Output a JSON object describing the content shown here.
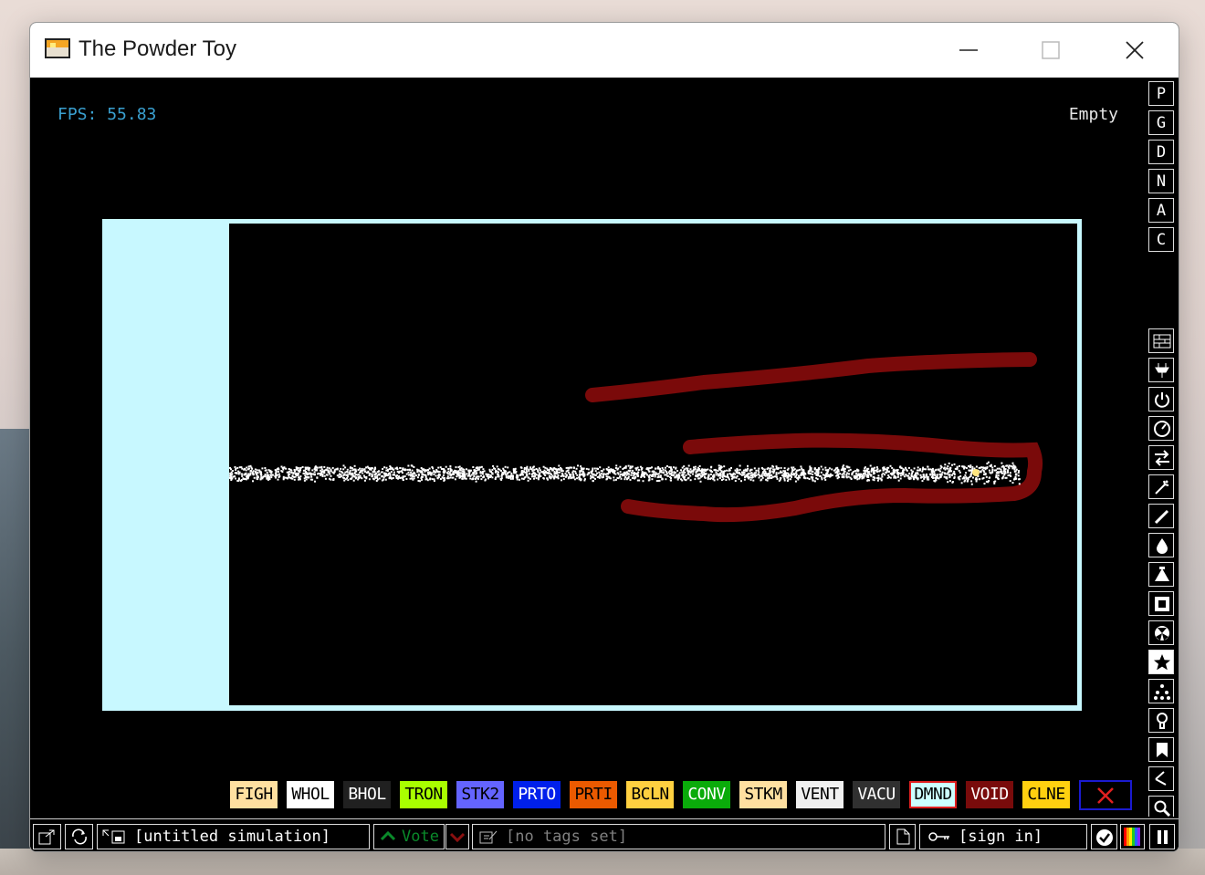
{
  "window": {
    "title": "The Powder Toy"
  },
  "hud": {
    "fps_label": "FPS:",
    "fps_value": "55.83",
    "hover_element": "Empty"
  },
  "right_toolbar": {
    "top_buttons": [
      "P",
      "G",
      "D",
      "N",
      "A",
      "C"
    ],
    "menu_icons": [
      "walls-icon",
      "electronics-icon",
      "powered-icon",
      "sensors-icon",
      "force-icon",
      "explosives-icon",
      "gases-icon",
      "liquids-icon",
      "powders-icon",
      "solids-icon",
      "radioactive-icon",
      "special-icon",
      "particles-icon",
      "life-icon",
      "tools-icon",
      "favorites-icon",
      "search-icon"
    ],
    "active_menu": "special-icon"
  },
  "elements": [
    {
      "name": "FIGH",
      "bg": "#ffe0a0",
      "fg": "#000000"
    },
    {
      "name": "WHOL",
      "bg": "#ffffff",
      "fg": "#000000"
    },
    {
      "name": "BHOL",
      "bg": "#202020",
      "fg": "#ffffff"
    },
    {
      "name": "TRON",
      "bg": "#a9ff00",
      "fg": "#000000"
    },
    {
      "name": "STK2",
      "bg": "#6464ff",
      "fg": "#000000"
    },
    {
      "name": "PRTO",
      "bg": "#0020eb",
      "fg": "#ffffff"
    },
    {
      "name": "PRTI",
      "bg": "#eb5a00",
      "fg": "#000000"
    },
    {
      "name": "BCLN",
      "bg": "#ffd040",
      "fg": "#000000"
    },
    {
      "name": "CONV",
      "bg": "#0aab0a",
      "fg": "#ffffff"
    },
    {
      "name": "STKM",
      "bg": "#ffe0a0",
      "fg": "#000000"
    },
    {
      "name": "VENT",
      "bg": "#f0f0f0",
      "fg": "#000000"
    },
    {
      "name": "VACU",
      "bg": "#303030",
      "fg": "#ffffff"
    },
    {
      "name": "DMND",
      "bg": "#ccffff",
      "fg": "#000000",
      "selected": true
    },
    {
      "name": "VOID",
      "bg": "#790b0b",
      "fg": "#ffffff"
    },
    {
      "name": "CLNE",
      "bg": "#ffd010",
      "fg": "#000000"
    }
  ],
  "clear_tool": {
    "icon": "close-icon",
    "color": "#e02020"
  },
  "bottom_bar": {
    "save_title": "[untitled simulation]",
    "vote_label": "Vote",
    "tags_label": "[no tags set]",
    "sign_in_label": "[sign in]"
  },
  "colors": {
    "sim_border": "#c8f8ff",
    "wall": "#7a0a0a",
    "fps": "#3aa0d0"
  }
}
